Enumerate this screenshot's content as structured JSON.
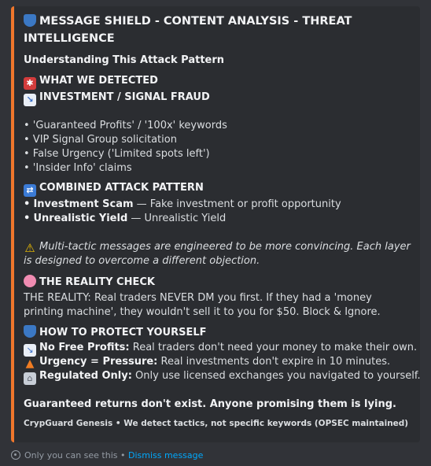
{
  "embed": {
    "accent": "#f0772c",
    "title": "MESSAGE SHIELD - CONTENT ANALYSIS - THREAT INTELLIGENCE",
    "subheading": "Understanding This Attack Pattern",
    "detected_heading": "WHAT WE DETECTED",
    "fraud_heading": "INVESTMENT / SIGNAL FRAUD",
    "bullets": [
      "• 'Guaranteed Profits' / '100x' keywords",
      "• VIP Signal Group solicitation",
      "• False Urgency ('Limited spots left')",
      "• 'Insider Info' claims"
    ],
    "combined_heading": "COMBINED ATTACK PATTERN",
    "combined_items": [
      {
        "label": "Investment Scam",
        "text": " — Fake investment or profit opportunity"
      },
      {
        "label": "Unrealistic Yield",
        "text": " — Unrealistic Yield"
      }
    ],
    "bullet_char": "•",
    "warning_text": "Multi-tactic messages are engineered to be more convincing. Each layer is designed to overcome a different objection.",
    "reality_heading": "THE REALITY CHECK",
    "reality_text": "THE REALITY: Real traders NEVER DM you first. If they had a 'money printing machine', they wouldn't sell it to you for $50. Block & Ignore.",
    "protect_heading": "HOW TO PROTECT YOURSELF",
    "protect_items": [
      {
        "label": "No Free Profits:",
        "text": " Real traders don't need your money to make their own."
      },
      {
        "label": "Urgency = Pressure:",
        "text": " Real investments don't expire in 10 minutes."
      },
      {
        "label": "Regulated Only:",
        "text": " Only use licensed exchanges you navigated to yourself."
      }
    ],
    "closing": "Guaranteed returns don't exist. Anyone promising them is lying.",
    "footer": "CrypGuard Genesis • We detect tactics, not specific keywords (OPSEC maintained)"
  },
  "ephemeral": {
    "text": "Only you can see this • ",
    "dismiss": "Dismiss message"
  },
  "icons": [
    "shield-icon",
    "siren-icon",
    "chart-down-icon",
    "shuffle-icon",
    "warning-icon",
    "brain-icon",
    "cone-icon",
    "bank-icon",
    "eye-icon"
  ]
}
